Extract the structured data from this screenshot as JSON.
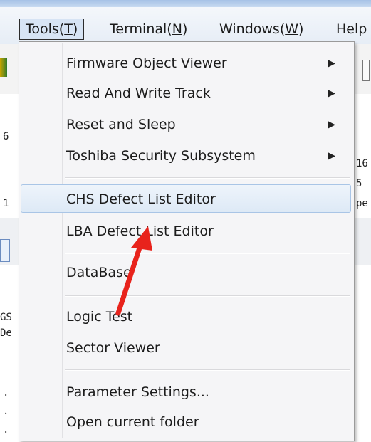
{
  "menubar": {
    "items": [
      {
        "label": "Tools(T)",
        "display": "Tools(",
        "key": "T",
        "tail": ")"
      },
      {
        "label": "Terminal(N)",
        "display": "Terminal(",
        "key": "N",
        "tail": ")"
      },
      {
        "label": "Windows(W)",
        "display": "Windows(",
        "key": "W",
        "tail": ")"
      },
      {
        "label": "Help",
        "display": "Help",
        "key": "",
        "tail": ""
      }
    ]
  },
  "tools_menu": {
    "groups": [
      [
        {
          "label": "Firmware Object Viewer",
          "submenu": true
        },
        {
          "label": "Read And Write Track",
          "submenu": true
        },
        {
          "label": "Reset and Sleep",
          "submenu": true
        },
        {
          "label": "Toshiba Security Subsystem",
          "submenu": true
        }
      ],
      [
        {
          "label": "CHS Defect List Editor",
          "submenu": false,
          "highlighted": true
        },
        {
          "label": "LBA Defect List Editor",
          "submenu": false
        }
      ],
      [
        {
          "label": "DataBase",
          "submenu": false
        }
      ],
      [
        {
          "label": "Logic Test",
          "submenu": false
        },
        {
          "label": "Sector Viewer",
          "submenu": false
        }
      ],
      [
        {
          "label": "Parameter Settings...",
          "submenu": false
        },
        {
          "label": "Open current folder",
          "submenu": false
        }
      ]
    ]
  },
  "background_fragments": {
    "left": [
      "6",
      "1",
      "GS",
      "De",
      "·",
      "·",
      "·"
    ],
    "right": [
      "16",
      "5",
      "pe"
    ]
  },
  "colors": {
    "annotation_arrow": "#e8231c",
    "highlight_border": "#a9c5e6"
  },
  "icons": {
    "submenu_arrow": "submenu-arrow-icon",
    "annotation": "red-arrow-annotation"
  }
}
